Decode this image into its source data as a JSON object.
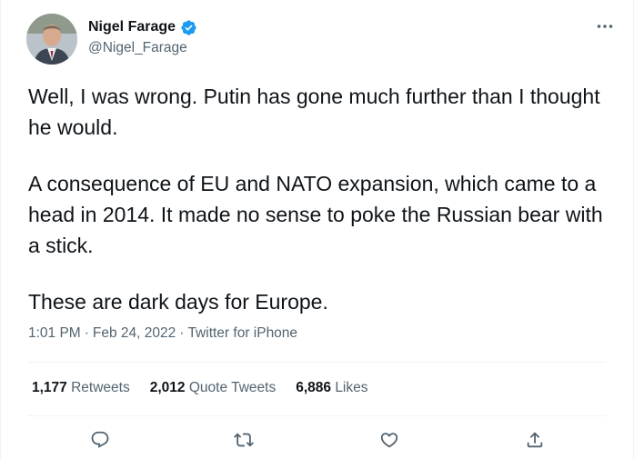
{
  "author": {
    "display_name": "Nigel Farage",
    "handle": "@Nigel_Farage",
    "verified": true
  },
  "tweet": {
    "paragraphs": [
      "Well, I was wrong. Putin has gone much further than I thought he would.",
      "A consequence of EU and NATO expansion, which came to a head in 2014. It made no sense to poke the Russian bear with a stick.",
      "These are dark days for Europe."
    ],
    "time": "1:01 PM",
    "date": "Feb 24, 2022",
    "source": "Twitter for iPhone",
    "separator": "·"
  },
  "stats": {
    "retweets_count": "1,177",
    "retweets_label": "Retweets",
    "quotes_count": "2,012",
    "quotes_label": "Quote Tweets",
    "likes_count": "6,886",
    "likes_label": "Likes"
  },
  "icons": {
    "more": "more-horizontal-icon",
    "verified": "verified-badge-icon",
    "reply": "reply-icon",
    "retweet": "retweet-icon",
    "like": "like-icon",
    "share": "share-icon"
  },
  "colors": {
    "text_primary": "#0f1419",
    "text_secondary": "#536471",
    "verified_blue": "#1d9bf0",
    "divider": "#eff3f4"
  }
}
